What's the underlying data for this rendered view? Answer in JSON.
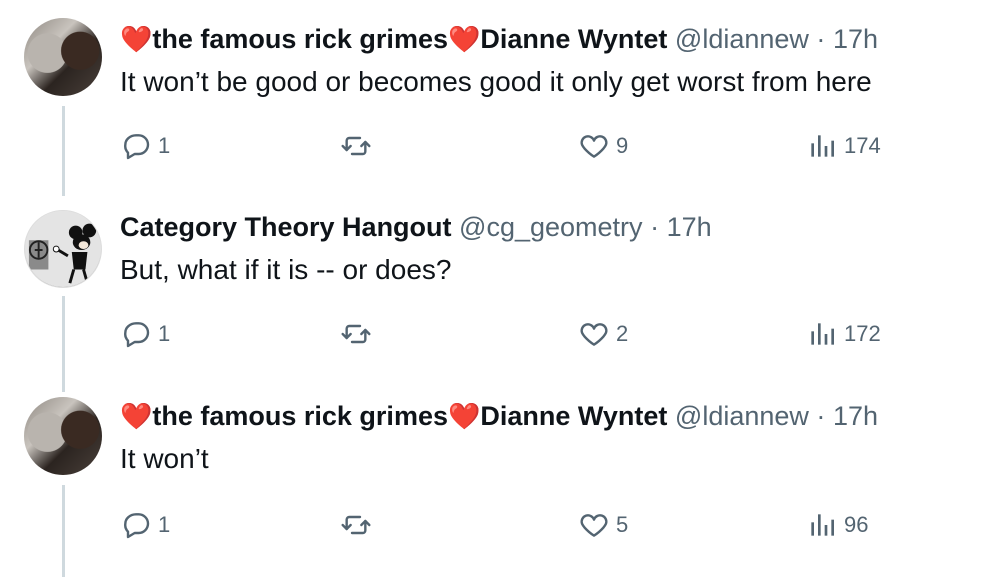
{
  "tweets": [
    {
      "heart1": "❤️",
      "display_name_a": "the famous rick grimes",
      "heart2": "❤️",
      "display_name_b": "Dianne Wyntet",
      "handle": "@ldiannew",
      "separator": "·",
      "time": "17h",
      "text": "It won’t be good or becomes good it only get worst from here",
      "replies": "1",
      "retweets": "",
      "likes": "9",
      "views": "174"
    },
    {
      "display_name": "Category Theory Hangout",
      "handle": "@cg_geometry",
      "separator": "·",
      "time": "17h",
      "text": "But, what if it is -- or does?",
      "replies": "1",
      "retweets": "",
      "likes": "2",
      "views": "172"
    },
    {
      "heart1": "❤️",
      "display_name_a": "the famous rick grimes",
      "heart2": "❤️",
      "display_name_b": "Dianne Wyntet",
      "handle": "@ldiannew",
      "separator": "·",
      "time": "17h",
      "text": "It won’t",
      "replies": "1",
      "retweets": "",
      "likes": "5",
      "views": "96"
    }
  ],
  "icons": {
    "reply": "reply-icon",
    "retweet": "retweet-icon",
    "like": "heart-icon",
    "views": "views-icon"
  },
  "colors": {
    "text": "#0f1419",
    "secondary": "#536471",
    "heart_emoji": "#e0245e",
    "thread_line": "#cfd9de"
  }
}
